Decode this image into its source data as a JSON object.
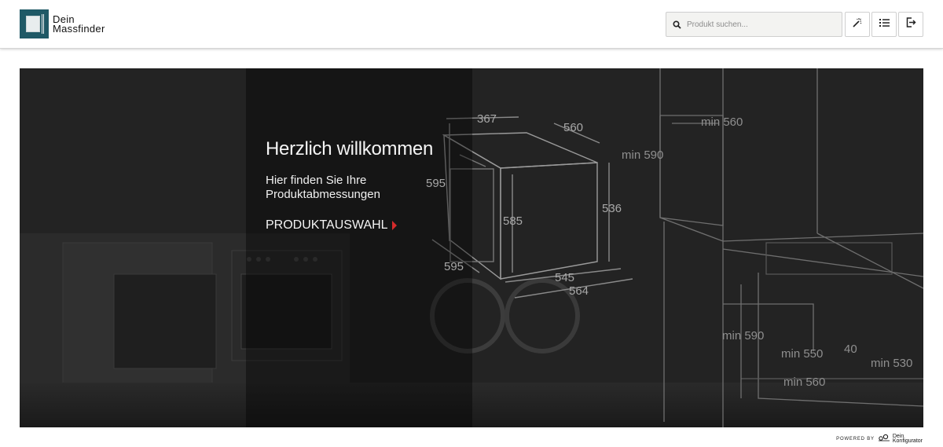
{
  "header": {
    "logo_line1": "Dein",
    "logo_line2": "Massfinder",
    "search": {
      "placeholder": "Produkt suchen..."
    }
  },
  "hero": {
    "title": "Herzlich willkommen",
    "subtitle": "Hier finden Sie Ihre Produktabmessungen",
    "cta_label": "PRODUKTAUSWAHL",
    "dimensions": {
      "oven_top_depth": "367",
      "oven_top_width": "560",
      "oven_height_outer": "595",
      "oven_height_inner": "585",
      "oven_side_height": "536",
      "oven_bottom_depth": "595",
      "oven_bottom_width1": "545",
      "oven_bottom_width2": "564",
      "niche_top_width": "min 560",
      "niche_top_height": "min 590",
      "niche_bottom_height": "min 590",
      "niche_bottom_width1": "min 550",
      "niche_bottom_gap": "40",
      "niche_bottom_depth": "min 530",
      "niche_bottom_width2": "min 560"
    }
  },
  "footer": {
    "powered_by": "POWERED BY",
    "brand_line1": "Dein",
    "brand_line2": "Konfigurator"
  },
  "colors": {
    "brand": "#1f5966",
    "hero_bg": "#242424",
    "accent_arrow": "#d42b2b"
  }
}
